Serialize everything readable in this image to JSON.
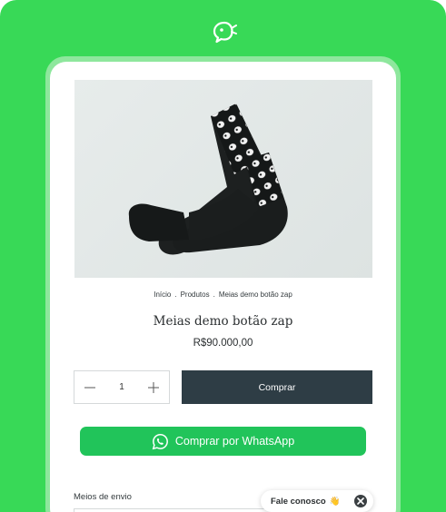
{
  "app": {
    "logo_icon": "fish-chat-logo-icon",
    "accent_color": "#38d957",
    "buy_button_color": "#2e3d45",
    "whatsapp_color": "#21c45a"
  },
  "product": {
    "image_alt": "Meias demo botão zap",
    "breadcrumb": [
      "Início",
      "Produtos",
      "Meias demo botão zap"
    ],
    "breadcrumb_separator": ".",
    "title": "Meias demo botão zap",
    "price": "R$90.000,00"
  },
  "quantity": {
    "value": "1",
    "minus_icon": "minus-icon",
    "plus_icon": "plus-icon"
  },
  "actions": {
    "buy_label": "Comprar",
    "whatsapp_label": "Comprar por WhatsApp",
    "whatsapp_icon": "whatsapp-icon"
  },
  "shipping": {
    "label": "Meios de envio"
  },
  "chat": {
    "label": "Fale conosco",
    "emoji": "👋",
    "close_icon": "close-icon"
  }
}
